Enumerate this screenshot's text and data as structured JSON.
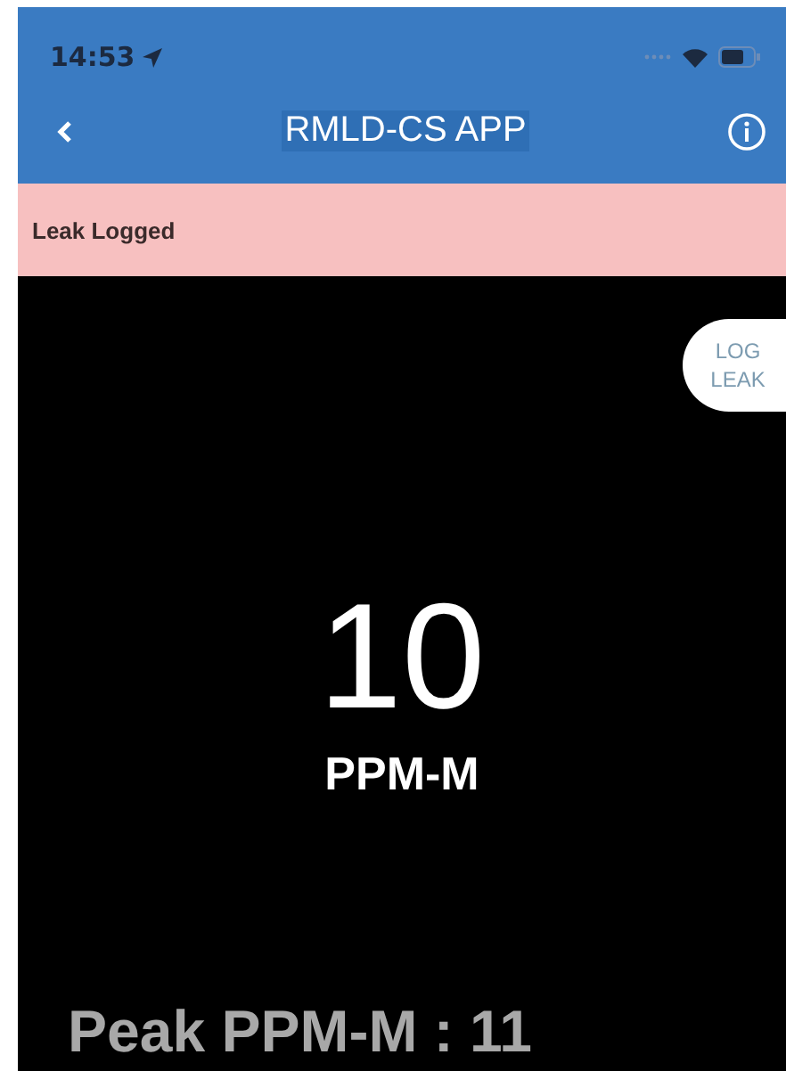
{
  "status_bar": {
    "time": "14:53"
  },
  "nav_bar": {
    "title": "RMLD-CS APP"
  },
  "banner": {
    "message": "Leak Logged"
  },
  "log_button": {
    "line_1": "LOG",
    "line_2": "LEAK"
  },
  "reading": {
    "value": "10",
    "unit": "PPM-M"
  },
  "peak": {
    "text": "Peak PPM-M : 11"
  }
}
